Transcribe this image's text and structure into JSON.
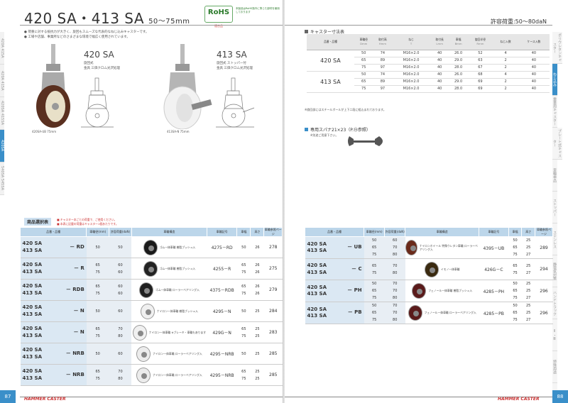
{
  "left": {
    "title": "420 SA・413 SA",
    "subtitle": "50～75mm",
    "rohs": {
      "mark": "RoHS",
      "caption": "適合品",
      "note": "本製品はRoHS指令に準じた部材を使用しております"
    },
    "notes": [
      "● 荷重に対する抵抗力が大きく、旋回もスムーズな代表的なねじ込みキャスターです。",
      "● 工場や店舗、事業所などのさまざまな環境で幅広く使用されています。"
    ],
    "prod1": {
      "name": "420 SA",
      "type": "旋回式",
      "finish": "金具 三価クロム光沢処理",
      "caption": "420SA-UB 75mm"
    },
    "prod2": {
      "name": "413 SA",
      "type": "旋回式 ストッパー付",
      "finish": "金具 三価クロム光沢処理",
      "caption": "413SA-N 75mm"
    },
    "tabs": [
      "420A 415A",
      "420A 415A",
      "420SA 415SA",
      "420SA",
      "540SA 545SA"
    ],
    "sel_title": "商品選択表",
    "sel_note": [
      "■ キャスター本ごとの荷重で、ご使用ください。",
      "■ 本表に記載の荷重はキャスター1個あたりです。"
    ],
    "headers": {
      "group": "商品記号",
      "code": "品番・品種",
      "wheel": "車輪",
      "dia": "車輪径(mm)",
      "load": "許容荷重(daN)",
      "structure": "車輪構造",
      "model": "車輪記号",
      "w": "車幅",
      "h": "高さ",
      "ref": "車輪参照ページ"
    },
    "rows": [
      {
        "c1": "420 SA",
        "c2": "413 SA",
        "sfx": "－ RD",
        "sizes": [
          "50"
        ],
        "loads": [
          "50"
        ],
        "desc": "ゴム一体車輪 樹脂ブッシュ入",
        "model": "4275－RD",
        "w": [
          "50"
        ],
        "h": [
          "26"
        ],
        "ref": "278",
        "color": "#1a1a1a"
      },
      {
        "c1": "420 SA",
        "c2": "413 SA",
        "sfx": "－ R",
        "sizes": [
          "65",
          "75"
        ],
        "loads": [
          "60",
          "60"
        ],
        "desc": "ゴム一体車輪 樹脂ブッシュ入",
        "model": "4255－R",
        "w": [
          "65",
          "75"
        ],
        "h": [
          "26",
          "26"
        ],
        "ref": "275",
        "color": "#222"
      },
      {
        "c1": "420 SA",
        "c2": "413 SA",
        "sfx": "－ RDB",
        "sizes": [
          "65",
          "75"
        ],
        "loads": [
          "60",
          "60"
        ],
        "desc": "ゴム一体車輪 ローラーベアリング入",
        "model": "4375－RDB",
        "w": [
          "65",
          "75"
        ],
        "h": [
          "26",
          "26"
        ],
        "ref": "279",
        "color": "#202020"
      },
      {
        "c1": "420 SA",
        "c2": "413 SA",
        "sfx": "－ N",
        "sizes": [
          "50"
        ],
        "loads": [
          "60"
        ],
        "desc": "ナイロン一体車輪 樹脂ブッシュ入",
        "model": "4295－N",
        "w": [
          "50"
        ],
        "h": [
          "25"
        ],
        "ref": "284",
        "color": "#f0f0f0"
      },
      {
        "c1": "420 SA",
        "c2": "413 SA",
        "sfx": "－ N",
        "sizes": [
          "65",
          "75"
        ],
        "loads": [
          "70",
          "80"
        ],
        "desc": "ナイロン一体車輪 ※ブレーキ・車輪もあります",
        "model": "429G－N",
        "w": [
          "65",
          "75"
        ],
        "h": [
          "25",
          "25"
        ],
        "ref": "283",
        "color": "#f0f0f0"
      },
      {
        "c1": "420 SA",
        "c2": "413 SA",
        "sfx": "－ NRB",
        "sizes": [
          "50"
        ],
        "loads": [
          "60"
        ],
        "desc": "ナイロン一体車輪 ローラーベアリング入",
        "model": "4295－NRB",
        "w": [
          "50"
        ],
        "h": [
          "25"
        ],
        "ref": "285",
        "color": "#ececec"
      },
      {
        "c1": "420 SA",
        "c2": "413 SA",
        "sfx": "－ NRB",
        "sizes": [
          "65",
          "75"
        ],
        "loads": [
          "70",
          "80"
        ],
        "desc": "ナイロン一体車輪 ローラーベアリング入",
        "model": "4295－NRB",
        "w": [
          "65",
          "75"
        ],
        "h": [
          "25",
          "25"
        ],
        "ref": "285",
        "color": "#ececec"
      }
    ],
    "page": "87",
    "brand": "HAMMER CASTER"
  },
  "right": {
    "load": "許容荷重:50～80daN",
    "dims_title": "キャスター寸法表",
    "dims_headers": [
      "品番・品種",
      "車輪径",
      "取付高",
      "ねじ",
      "取付長",
      "車幅",
      "旋回半径",
      "ねじ入数",
      "ケース入数"
    ],
    "dims_units": [
      "Dmm",
      "Hmm",
      "T",
      "Lmm",
      "Bmm",
      "Rmm",
      "",
      ""
    ],
    "dims_groups": [
      {
        "name": "420 SA",
        "rows": [
          [
            "50",
            "74",
            "M16×2.0",
            "40",
            "26.0",
            "52",
            "4",
            "40"
          ],
          [
            "65",
            "89",
            "M16×2.0",
            "40",
            "29.0",
            "63",
            "2",
            "40"
          ],
          [
            "75",
            "97",
            "M16×2.0",
            "40",
            "28.0",
            "67",
            "2",
            "40"
          ]
        ]
      },
      {
        "name": "413 SA",
        "rows": [
          [
            "50",
            "74",
            "M16×2.0",
            "40",
            "26.0",
            "68",
            "4",
            "40"
          ],
          [
            "65",
            "89",
            "M16×2.0",
            "40",
            "29.0",
            "69",
            "2",
            "40"
          ],
          [
            "75",
            "97",
            "M16×2.0",
            "40",
            "28.0",
            "69",
            "2",
            "40"
          ]
        ]
      }
    ],
    "dims_note": "※旋回部にはスチールボールが上下二段に組込まれております。",
    "spanner_title": "専用スパナ21×23（P.⑮参照）",
    "spanner_note": "※別途ご用意下さい。",
    "rows": [
      {
        "c1": "420 SA",
        "c2": "413 SA",
        "sfx": "－ UB",
        "sizes": [
          "50",
          "65",
          "75"
        ],
        "loads": [
          "60",
          "70",
          "80"
        ],
        "desc": "ナイロンホイール 特殊ウレタン車輪 ローラーベアリング入",
        "model": "4395－UB",
        "w": [
          "50",
          "65",
          "75"
        ],
        "h": [
          "25",
          "25",
          "27"
        ],
        "ref": "289",
        "color": "#6a2a1a"
      },
      {
        "c1": "420 SA",
        "c2": "413 SA",
        "sfx": "－ C",
        "sizes": [
          "65",
          "75"
        ],
        "loads": [
          "70",
          "80"
        ],
        "desc": "イモノ一体車輪",
        "model": "426G－C",
        "w": [
          "65",
          "75"
        ],
        "h": [
          "25",
          "27"
        ],
        "ref": "294",
        "color": "#3a2a10"
      },
      {
        "c1": "420 SA",
        "c2": "413 SA",
        "sfx": "－ PH",
        "sizes": [
          "50",
          "65",
          "75"
        ],
        "loads": [
          "70",
          "70",
          "80"
        ],
        "desc": "フェノール一体車輪 樹脂ブッシュ入",
        "model": "4285－PH",
        "w": [
          "50",
          "65",
          "75"
        ],
        "h": [
          "25",
          "25",
          "27"
        ],
        "ref": "296",
        "color": "#5a1a1a"
      },
      {
        "c1": "420 SA",
        "c2": "413 SA",
        "sfx": "－ PB",
        "sizes": [
          "50",
          "65",
          "75"
        ],
        "loads": [
          "70",
          "70",
          "80"
        ],
        "desc": "フェノール一体車輪 ローラーベアリング入",
        "model": "4285－PB",
        "w": [
          "50",
          "65",
          "75"
        ],
        "h": [
          "25",
          "25",
          "27"
        ],
        "ref": "296",
        "color": "#5a1a1a"
      }
    ],
    "tabs": [
      "ポリウレタンキャスター",
      "ねじ込み",
      "重量用キャスター",
      "プレート式キャスター",
      "車輪単品",
      "ストッパー",
      "ステンレス",
      "静電気対策",
      "ハンドトラック",
      "Ⅱ・Ⅲ",
      "特殊用途",
      "特殊品"
    ],
    "page": "88",
    "brand": "HAMMER CASTER"
  }
}
